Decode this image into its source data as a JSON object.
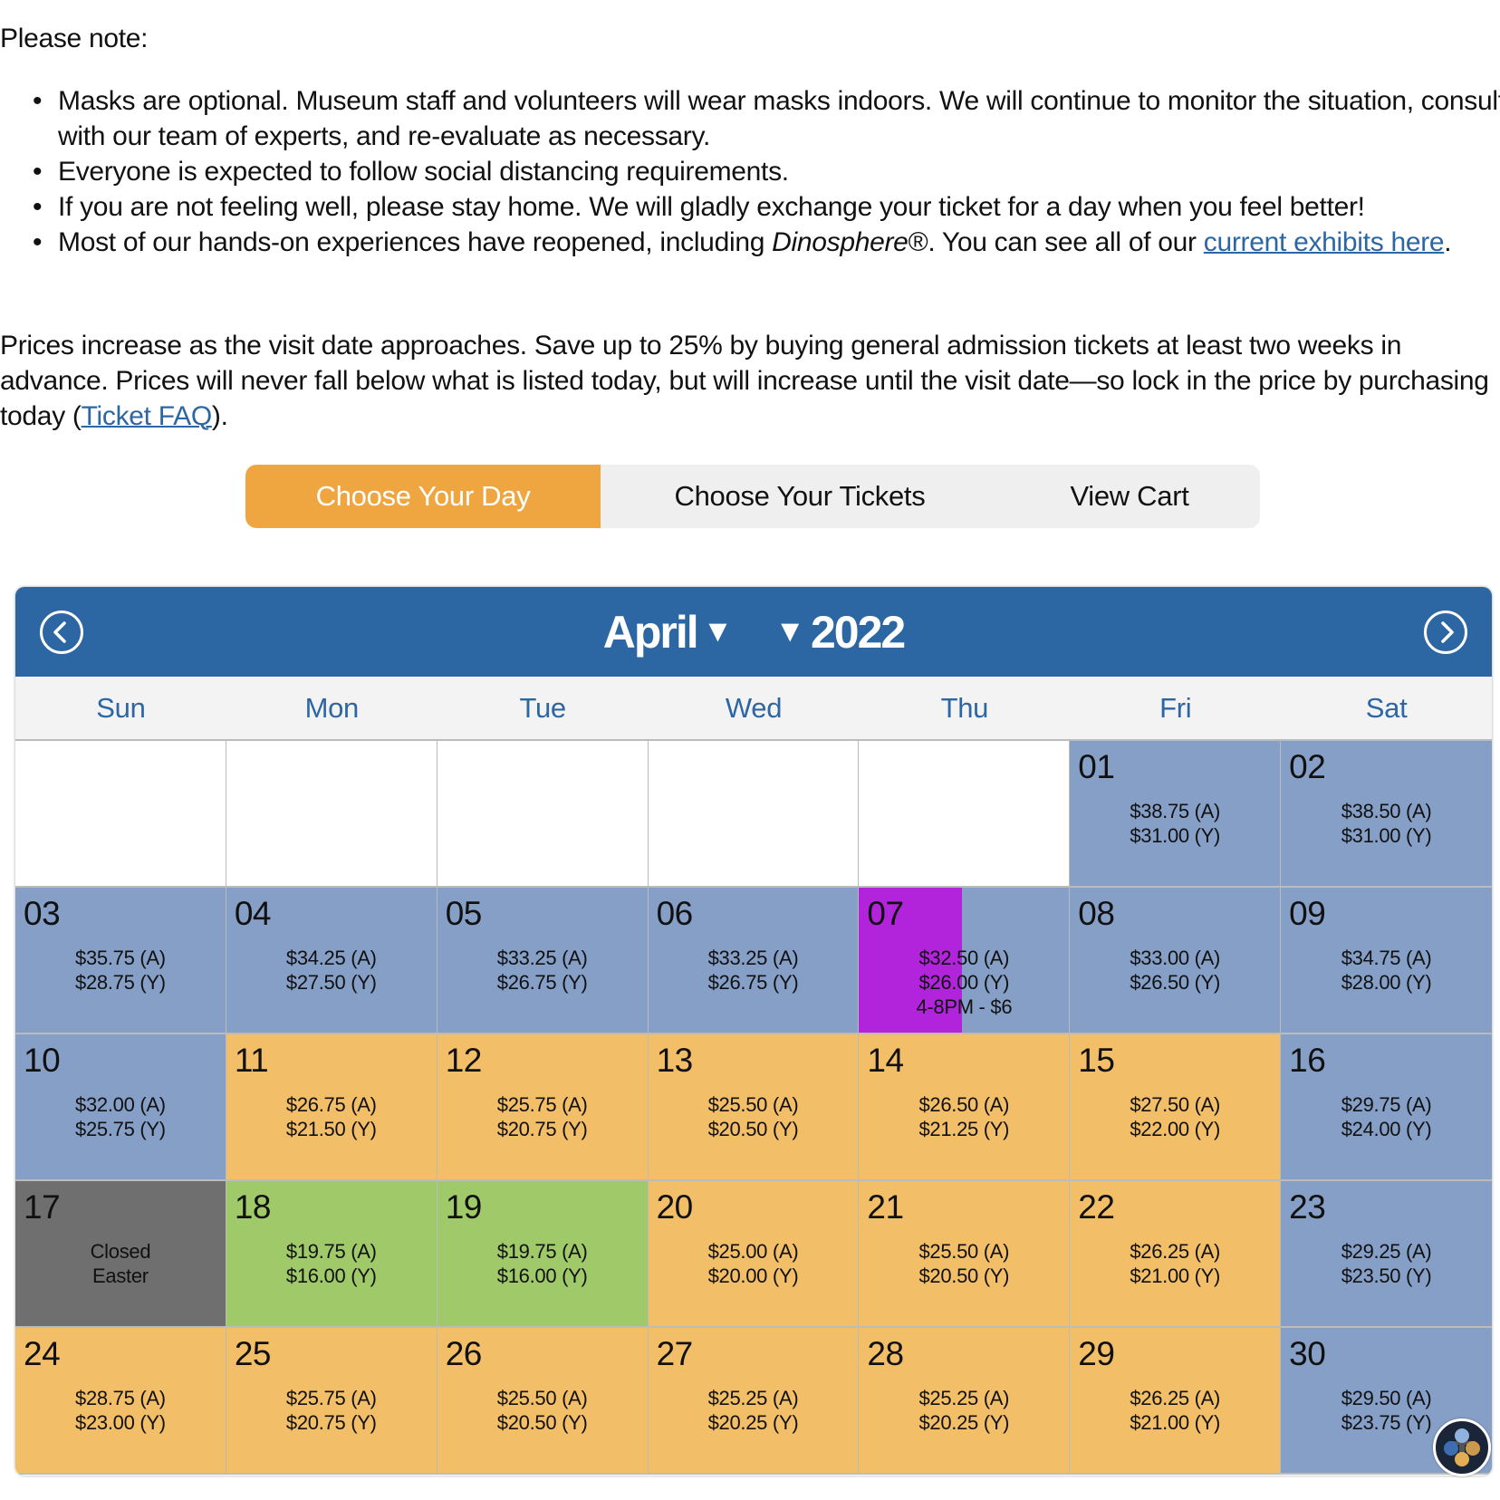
{
  "notice": {
    "title": "Please note:",
    "bullets": [
      {
        "text": "Masks are optional. Museum staff and volunteers will wear masks indoors. We will continue to monitor the situation, consult with our team of experts, and re-evaluate as necessary."
      },
      {
        "text": "Everyone is expected to follow social distancing requirements."
      },
      {
        "text": "If you are not feeling well, please stay home. We will gladly exchange your ticket for a day when you feel better!"
      },
      {
        "text_before": "Most of our hands-on experiences have reopened, including ",
        "italic": "Dinosphere",
        "reg": "®",
        "text_middle": ". You can see all of our ",
        "link": "current exhibits here",
        "text_after": "."
      }
    ]
  },
  "pricing_note": {
    "text": "Prices increase as the visit date approaches. Save up to 25% by buying general admission tickets at least two weeks in advance. Prices will never fall below what is listed today, but will increase until the visit date—so lock in the price by purchasing today (",
    "link": "Ticket FAQ",
    "text_after": ")."
  },
  "steps": {
    "active": "Choose Your Day",
    "step2": "Choose Your Tickets",
    "step3": "View Cart"
  },
  "calendar": {
    "month": "April",
    "year": "2022",
    "dropdown_glyph": "▼",
    "prev_icon": "chevron-left-circle",
    "next_icon": "chevron-right-circle",
    "weekdays": [
      "Sun",
      "Mon",
      "Tue",
      "Wed",
      "Thu",
      "Fri",
      "Sat"
    ],
    "leading_empty_days": 5,
    "colors": {
      "blue": "#859fc7",
      "orange": "#f3be68",
      "green": "#a0ca69",
      "gray": "#6f6f6f",
      "special": "#b224dc"
    },
    "days": [
      {
        "day": "01",
        "status": "blue",
        "lines": [
          "$38.75 (A)",
          "$31.00 (Y)"
        ]
      },
      {
        "day": "02",
        "status": "blue",
        "lines": [
          "$38.50 (A)",
          "$31.00 (Y)"
        ]
      },
      {
        "day": "03",
        "status": "blue",
        "lines": [
          "$35.75 (A)",
          "$28.75 (Y)"
        ]
      },
      {
        "day": "04",
        "status": "blue",
        "lines": [
          "$34.25 (A)",
          "$27.50 (Y)"
        ]
      },
      {
        "day": "05",
        "status": "blue",
        "lines": [
          "$33.25 (A)",
          "$26.75 (Y)"
        ]
      },
      {
        "day": "06",
        "status": "blue",
        "lines": [
          "$33.25 (A)",
          "$26.75 (Y)"
        ]
      },
      {
        "day": "07",
        "status": "blue",
        "special": true,
        "lines": [
          "$32.50 (A)",
          "$26.00 (Y)",
          "4-8PM - $6"
        ]
      },
      {
        "day": "08",
        "status": "blue",
        "lines": [
          "$33.00 (A)",
          "$26.50 (Y)"
        ]
      },
      {
        "day": "09",
        "status": "blue",
        "lines": [
          "$34.75 (A)",
          "$28.00 (Y)"
        ]
      },
      {
        "day": "10",
        "status": "blue",
        "lines": [
          "$32.00 (A)",
          "$25.75 (Y)"
        ]
      },
      {
        "day": "11",
        "status": "orange",
        "lines": [
          "$26.75 (A)",
          "$21.50 (Y)"
        ]
      },
      {
        "day": "12",
        "status": "orange",
        "lines": [
          "$25.75 (A)",
          "$20.75 (Y)"
        ]
      },
      {
        "day": "13",
        "status": "orange",
        "lines": [
          "$25.50 (A)",
          "$20.50 (Y)"
        ]
      },
      {
        "day": "14",
        "status": "orange",
        "lines": [
          "$26.50 (A)",
          "$21.25 (Y)"
        ]
      },
      {
        "day": "15",
        "status": "orange",
        "lines": [
          "$27.50 (A)",
          "$22.00 (Y)"
        ]
      },
      {
        "day": "16",
        "status": "blue",
        "lines": [
          "$29.75 (A)",
          "$24.00 (Y)"
        ]
      },
      {
        "day": "17",
        "status": "gray",
        "lines": [
          "Closed",
          "Easter"
        ]
      },
      {
        "day": "18",
        "status": "green",
        "lines": [
          "$19.75 (A)",
          "$16.00 (Y)"
        ]
      },
      {
        "day": "19",
        "status": "green",
        "lines": [
          "$19.75 (A)",
          "$16.00 (Y)"
        ]
      },
      {
        "day": "20",
        "status": "orange",
        "lines": [
          "$25.00 (A)",
          "$20.00 (Y)"
        ]
      },
      {
        "day": "21",
        "status": "orange",
        "lines": [
          "$25.50 (A)",
          "$20.50 (Y)"
        ]
      },
      {
        "day": "22",
        "status": "orange",
        "lines": [
          "$26.25 (A)",
          "$21.00 (Y)"
        ]
      },
      {
        "day": "23",
        "status": "blue",
        "lines": [
          "$29.25 (A)",
          "$23.50 (Y)"
        ]
      },
      {
        "day": "24",
        "status": "orange",
        "lines": [
          "$28.75 (A)",
          "$23.00 (Y)"
        ]
      },
      {
        "day": "25",
        "status": "orange",
        "lines": [
          "$25.75 (A)",
          "$20.75 (Y)"
        ]
      },
      {
        "day": "26",
        "status": "orange",
        "lines": [
          "$25.50 (A)",
          "$20.50 (Y)"
        ]
      },
      {
        "day": "27",
        "status": "orange",
        "lines": [
          "$25.25 (A)",
          "$20.25 (Y)"
        ]
      },
      {
        "day": "28",
        "status": "orange",
        "lines": [
          "$25.25 (A)",
          "$20.25 (Y)"
        ]
      },
      {
        "day": "29",
        "status": "orange",
        "lines": [
          "$26.25 (A)",
          "$21.00 (Y)"
        ]
      },
      {
        "day": "30",
        "status": "blue",
        "lines": [
          "$29.50 (A)",
          "$23.75 (Y)"
        ]
      }
    ]
  },
  "chat_widget": {
    "icon": "chat-assistant-avatar"
  }
}
